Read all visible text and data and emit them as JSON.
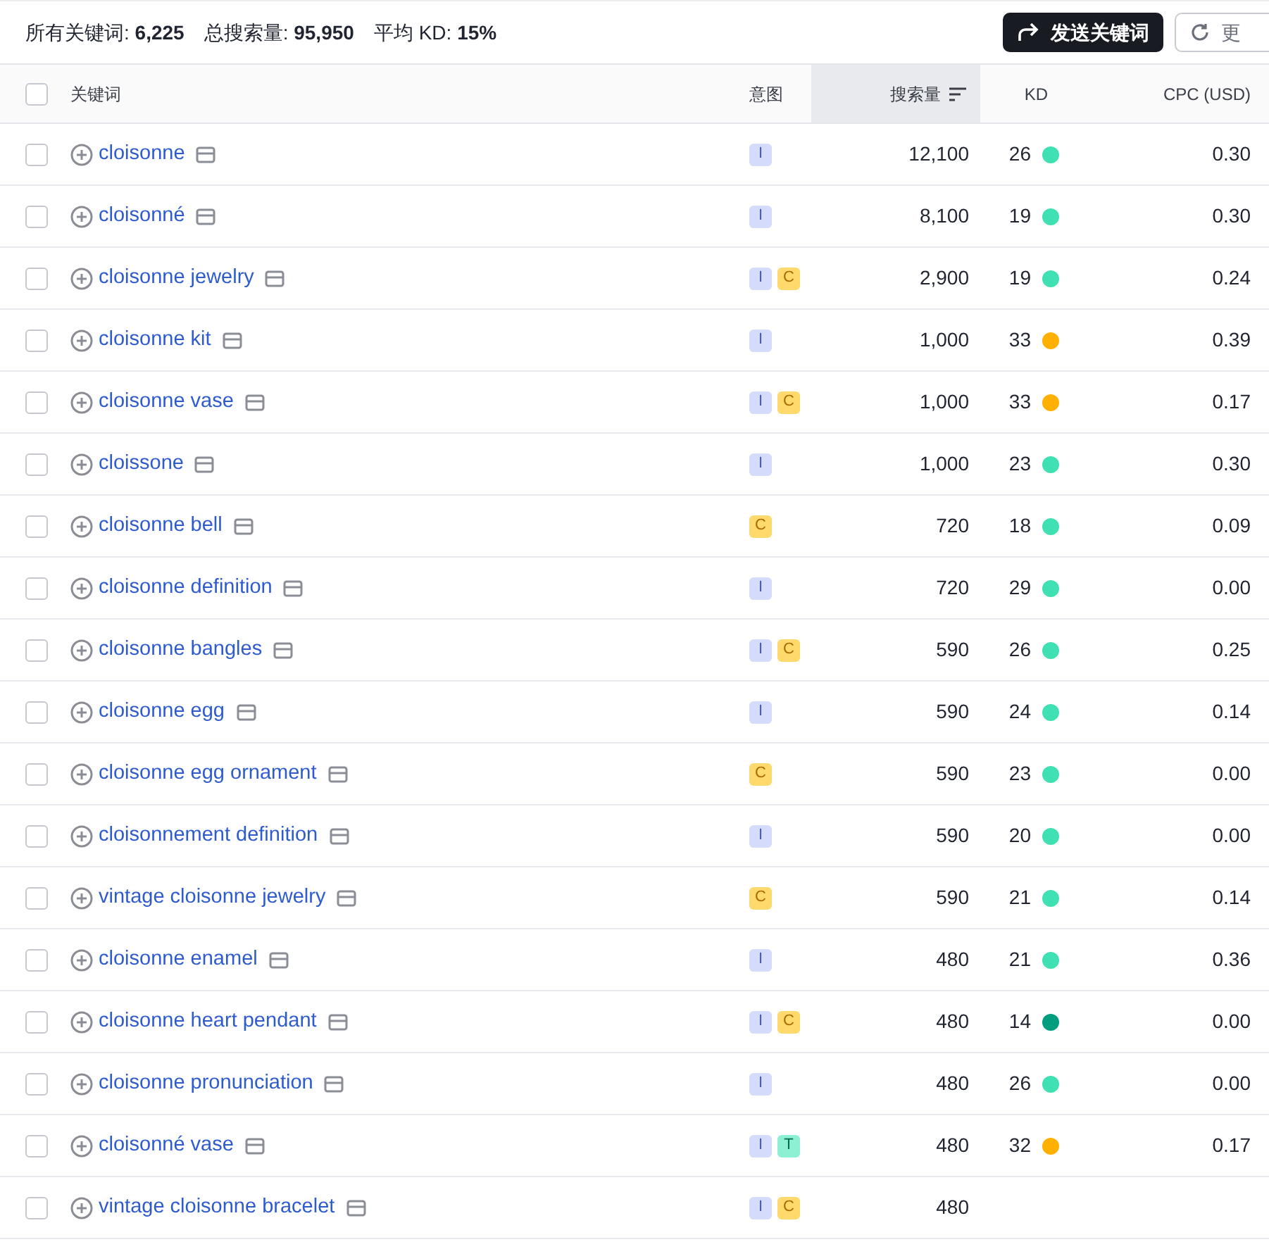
{
  "summary": [
    {
      "label": "所有关键词:",
      "value": "6,225"
    },
    {
      "label": "总搜索量:",
      "value": "95,950"
    },
    {
      "label": "平均 KD:",
      "value": "15%"
    }
  ],
  "actions": [
    {
      "label": "发送关键词",
      "kind": "primary"
    },
    {
      "label": "更",
      "kind": "secondary"
    }
  ],
  "table": {
    "columns": [
      "关键词",
      "意图",
      "搜索量",
      "KD",
      "CPC (USD)"
    ],
    "header_checked": false,
    "rows": [
      {
        "keyword": "cloisonne",
        "checked": false,
        "intents": [
          "I"
        ],
        "volume": "12,100",
        "kd": "26",
        "color": "#3fe0b4",
        "cpc": "0.30"
      },
      {
        "keyword": "cloisonné",
        "checked": false,
        "intents": [
          "I"
        ],
        "volume": "8,100",
        "kd": "19",
        "color": "#3fe0b4",
        "cpc": "0.30"
      },
      {
        "keyword": "cloisonne jewelry",
        "checked": false,
        "intents": [
          "I",
          "C"
        ],
        "volume": "2,900",
        "kd": "19",
        "color": "#3fe0b4",
        "cpc": "0.24"
      },
      {
        "keyword": "cloisonne kit",
        "checked": false,
        "intents": [
          "I"
        ],
        "volume": "1,000",
        "kd": "33",
        "color": "#ffb000",
        "cpc": "0.39"
      },
      {
        "keyword": "cloisonne vase",
        "checked": false,
        "intents": [
          "I",
          "C"
        ],
        "volume": "1,000",
        "kd": "33",
        "color": "#ffb000",
        "cpc": "0.17"
      },
      {
        "keyword": "cloissone",
        "checked": false,
        "intents": [
          "I"
        ],
        "volume": "1,000",
        "kd": "23",
        "color": "#3fe0b4",
        "cpc": "0.30"
      },
      {
        "keyword": "cloisonne bell",
        "checked": false,
        "intents": [
          "C"
        ],
        "volume": "720",
        "kd": "18",
        "color": "#3fe0b4",
        "cpc": "0.09"
      },
      {
        "keyword": "cloisonne definition",
        "checked": false,
        "intents": [
          "I"
        ],
        "volume": "720",
        "kd": "29",
        "color": "#3fe0b4",
        "cpc": "0.00"
      },
      {
        "keyword": "cloisonne bangles",
        "checked": false,
        "intents": [
          "I",
          "C"
        ],
        "volume": "590",
        "kd": "26",
        "color": "#3fe0b4",
        "cpc": "0.25"
      },
      {
        "keyword": "cloisonne egg",
        "checked": false,
        "intents": [
          "I"
        ],
        "volume": "590",
        "kd": "24",
        "color": "#3fe0b4",
        "cpc": "0.14"
      },
      {
        "keyword": "cloisonne egg ornament",
        "checked": false,
        "intents": [
          "C"
        ],
        "volume": "590",
        "kd": "23",
        "color": "#3fe0b4",
        "cpc": "0.00"
      },
      {
        "keyword": "cloisonnement definition",
        "checked": false,
        "intents": [
          "I"
        ],
        "volume": "590",
        "kd": "20",
        "color": "#3fe0b4",
        "cpc": "0.00"
      },
      {
        "keyword": "vintage cloisonne jewelry",
        "checked": false,
        "intents": [
          "C"
        ],
        "volume": "590",
        "kd": "21",
        "color": "#3fe0b4",
        "cpc": "0.14"
      },
      {
        "keyword": "cloisonne enamel",
        "checked": false,
        "intents": [
          "I"
        ],
        "volume": "480",
        "kd": "21",
        "color": "#3fe0b4",
        "cpc": "0.36"
      },
      {
        "keyword": "cloisonne heart pendant",
        "checked": false,
        "intents": [
          "I",
          "C"
        ],
        "volume": "480",
        "kd": "14",
        "color": "#009e7e",
        "cpc": "0.00"
      },
      {
        "keyword": "cloisonne pronunciation",
        "checked": false,
        "intents": [
          "I"
        ],
        "volume": "480",
        "kd": "26",
        "color": "#3fe0b4",
        "cpc": "0.00"
      },
      {
        "keyword": "cloisonné vase",
        "checked": false,
        "intents": [
          "I",
          "T"
        ],
        "volume": "480",
        "kd": "32",
        "color": "#ffb000",
        "cpc": "0.17"
      },
      {
        "keyword": "vintage cloisonne bracelet",
        "checked": false,
        "intents": [
          "I",
          "C"
        ],
        "volume": "480"
      }
    ]
  }
}
